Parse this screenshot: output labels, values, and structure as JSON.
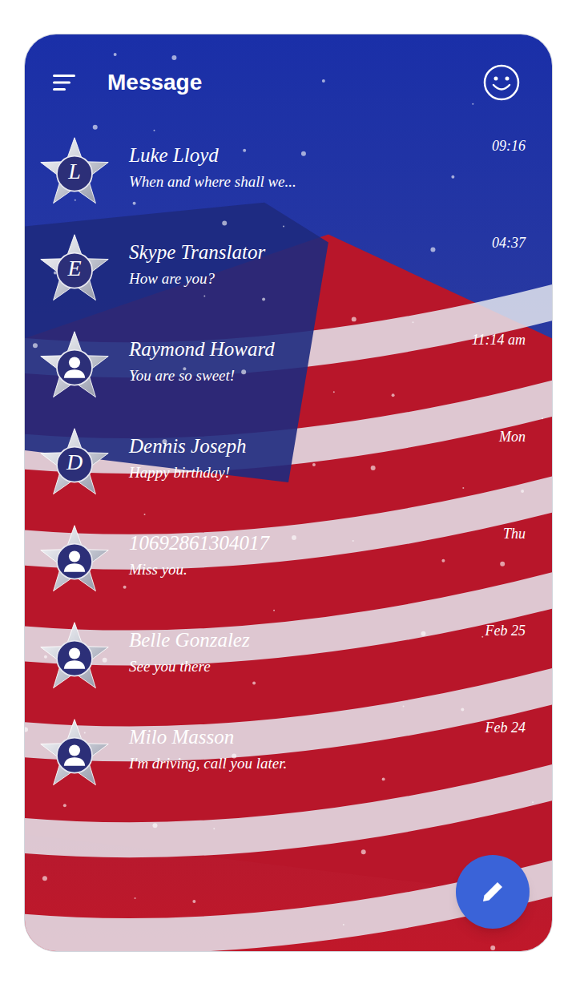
{
  "header": {
    "title": "Message"
  },
  "conversations": [
    {
      "name": "Luke Lloyd",
      "preview": "When and where shall we...",
      "time": "09:16",
      "avatar": {
        "kind": "letter",
        "letter": "L"
      }
    },
    {
      "name": "Skype Translator",
      "preview": "How are you?",
      "time": "04:37",
      "avatar": {
        "kind": "letter",
        "letter": "E"
      }
    },
    {
      "name": "Raymond Howard",
      "preview": "You are so sweet!",
      "time": "11:14 am",
      "avatar": {
        "kind": "person",
        "letter": ""
      }
    },
    {
      "name": "Dennis Joseph",
      "preview": "Happy birthday!",
      "time": "Mon",
      "avatar": {
        "kind": "letter",
        "letter": "D"
      }
    },
    {
      "name": "10692861304017",
      "preview": "Miss you.",
      "time": "Thu",
      "avatar": {
        "kind": "person",
        "letter": ""
      }
    },
    {
      "name": "Belle Gonzalez",
      "preview": "See you there",
      "time": "Feb 25",
      "avatar": {
        "kind": "person",
        "letter": ""
      }
    },
    {
      "name": "Milo Masson",
      "preview": "I'm driving, call you later.",
      "time": "Feb 24",
      "avatar": {
        "kind": "person",
        "letter": ""
      }
    }
  ]
}
